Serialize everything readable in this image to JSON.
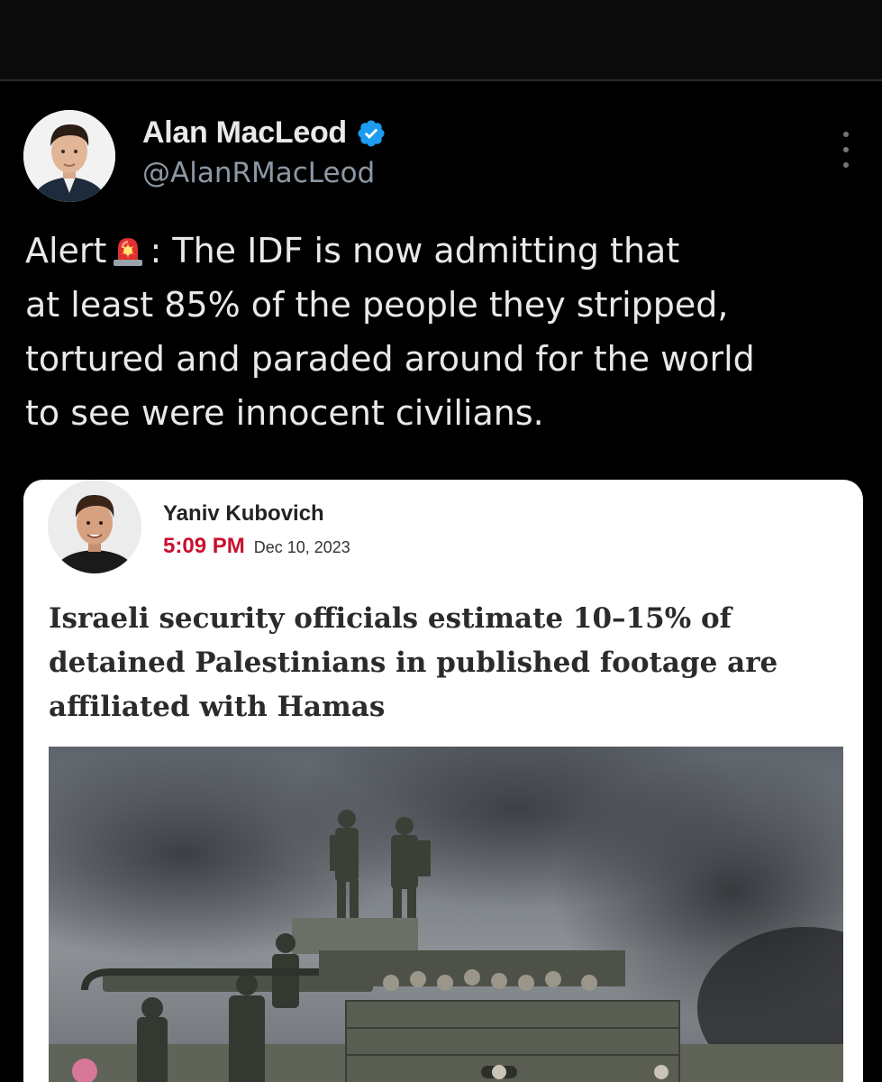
{
  "tweet": {
    "author_name": "Alan MacLeod",
    "handle": "@AlanRMacLeod",
    "verified": true,
    "text_lines": [
      "Alert",
      ": The IDF is now admitting that",
      "at least 85% of the people they stripped,",
      "tortured and paraded around for the world",
      "to see were innocent civilians."
    ]
  },
  "quoted": {
    "author": "Yaniv Kubovich",
    "time": "5:09 PM",
    "date": "Dec 10, 2023",
    "headline_lines": [
      "Israeli security officials estimate 10–15% of",
      "detained Palestinians in published footage are",
      "affiliated with Hamas"
    ]
  },
  "icons": {
    "verified": "verified-badge-icon",
    "more": "more-options-icon",
    "siren": "rotating-light-emoji"
  },
  "colors": {
    "background": "#000000",
    "text": "#e7e9ea",
    "secondary": "#8b98a5",
    "verified_blue": "#1d9bf0",
    "time_red": "#c8102e"
  }
}
